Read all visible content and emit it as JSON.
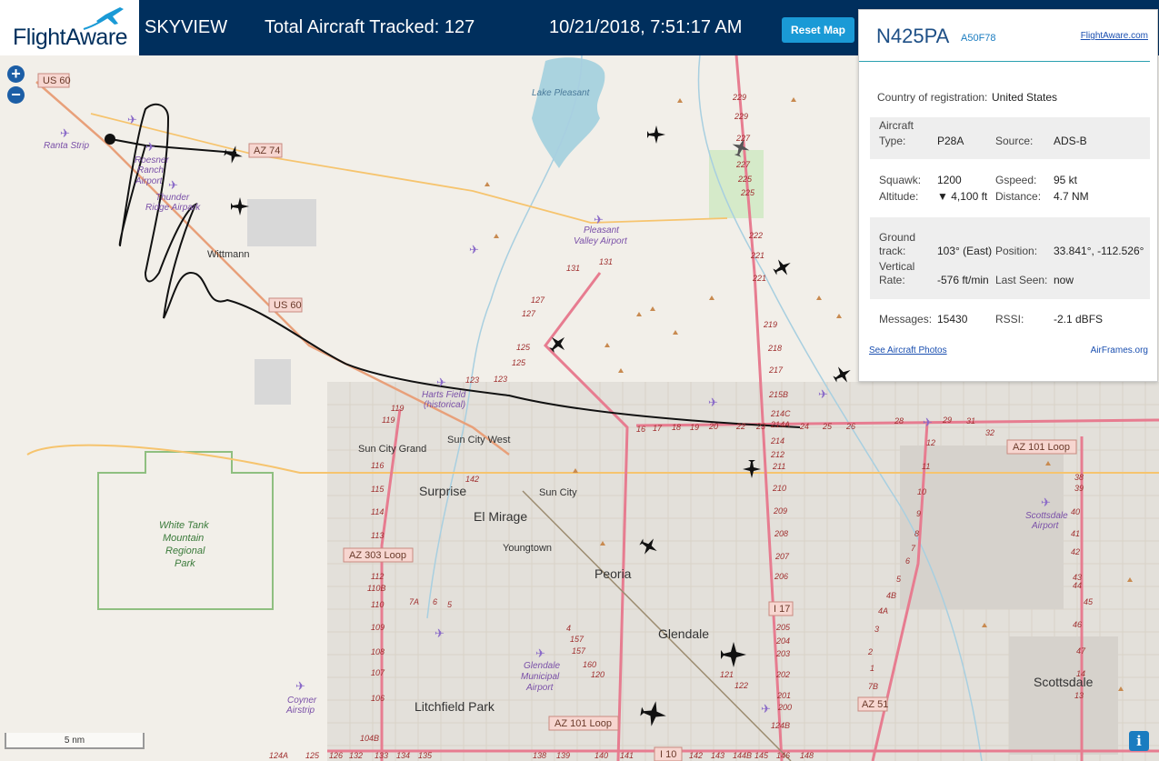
{
  "header": {
    "brand": "FlightAware",
    "app": "SKYVIEW",
    "tracked": "Total Aircraft Tracked: 127",
    "datetime": "10/21/2018, 7:51:17 AM",
    "reset": "Reset Map"
  },
  "zoom": {
    "in": "+",
    "out": "−"
  },
  "scale": "5 nm",
  "info_icon": "i",
  "panel": {
    "ident": "N425PA",
    "hex": "A50F78",
    "fa_link": "FlightAware.com",
    "country_label": "Country of registration:",
    "country": "United States",
    "aircraft_label": "Aircraft",
    "type_label": "Type:",
    "type": "P28A",
    "source_label": "Source:",
    "source": "ADS-B",
    "squawk_label": "Squawk:",
    "squawk": "1200",
    "gspeed_label": "Gspeed:",
    "gspeed": "95 kt",
    "altitude_label": "Altitude:",
    "altitude": "▼ 4,100 ft",
    "distance_label": "Distance:",
    "distance": "4.7 NM",
    "ground_label": "Ground",
    "track_label": "track:",
    "track": "103° (East)",
    "position_label": "Position:",
    "position": "33.841°, -112.526°",
    "vertical_label": "Vertical",
    "rate_label": "Rate:",
    "rate": "-576 ft/min",
    "lastseen_label": "Last Seen:",
    "lastseen": "now",
    "messages_label": "Messages:",
    "messages": "15430",
    "rssi_label": "RSSI:",
    "rssi": "-2.1 dBFS",
    "photos": "See Aircraft Photos",
    "airframes": "AirFrames.org"
  },
  "map": {
    "places": {
      "wittmann": "Wittmann",
      "sun_city_grand": "Sun City Grand",
      "sun_city_west": "Sun City West",
      "surprise": "Surprise",
      "sun_city": "Sun City",
      "el_mirage": "El Mirage",
      "youngtown": "Youngtown",
      "peoria": "Peoria",
      "glendale": "Glendale",
      "litchfield": "Litchfield Park",
      "scottsdale": "Scottsdale",
      "lake": "Lake Pleasant",
      "white_tank_1": "White Tank",
      "white_tank_2": "Mountain",
      "white_tank_3": "Regional",
      "white_tank_4": "Park"
    },
    "airports": {
      "ranta": "Ranta Strip",
      "roesner_1": "Roesner",
      "roesner_2": "Ranch",
      "roesner_3": "Airport",
      "thunder_1": "Thunder",
      "thunder_2": "Ridge Airpark",
      "pleasant_1": "Pleasant",
      "pleasant_2": "Valley Airport",
      "harts_1": "Harts Field",
      "harts_2": "(historical)",
      "glendale_1": "Glendale",
      "glendale_2": "Municipal",
      "glendale_3": "Airport",
      "coyner_1": "Coyner",
      "coyner_2": "Airstrip",
      "scottsdale_1": "Scottsdale",
      "scottsdale_2": "Airport"
    },
    "highways": {
      "us60a": "US 60",
      "us60b": "US 60",
      "az74": "AZ 74",
      "az303": "AZ 303 Loop",
      "az101a": "AZ 101 Loop",
      "az101b": "AZ 101 Loop",
      "i17": "I 17",
      "az51": "AZ 51",
      "i10": "I 10"
    },
    "miles": [
      "229",
      "229",
      "227",
      "227",
      "225",
      "225",
      "222",
      "221",
      "221",
      "219",
      "218",
      "217",
      "215B",
      "214C",
      "214A",
      "214",
      "212",
      "211",
      "210",
      "209",
      "208",
      "207",
      "206",
      "205",
      "204",
      "203",
      "202",
      "201",
      "200",
      "131",
      "131",
      "127",
      "127",
      "125",
      "125",
      "123",
      "123",
      "119",
      "119",
      "116",
      "115",
      "114",
      "113",
      "112",
      "110B",
      "110",
      "109",
      "108",
      "107",
      "106",
      "104B",
      "142",
      "16",
      "17",
      "18",
      "19",
      "20",
      "22",
      "23",
      "24",
      "25",
      "26",
      "28",
      "29",
      "31",
      "32",
      "38",
      "39",
      "40",
      "41",
      "42",
      "43",
      "44",
      "45",
      "46",
      "47",
      "14",
      "13",
      "12",
      "11",
      "10",
      "9",
      "8",
      "7",
      "6",
      "5",
      "4B",
      "4A",
      "3",
      "2",
      "1",
      "7B",
      "7A",
      "6",
      "5",
      "4",
      "157",
      "157",
      "160",
      "120",
      "121",
      "122",
      "124B",
      "124A",
      "125",
      "126",
      "132",
      "133",
      "134",
      "135",
      "138",
      "139",
      "140",
      "141",
      "142",
      "143",
      "144B",
      "145",
      "146",
      "148"
    ]
  }
}
